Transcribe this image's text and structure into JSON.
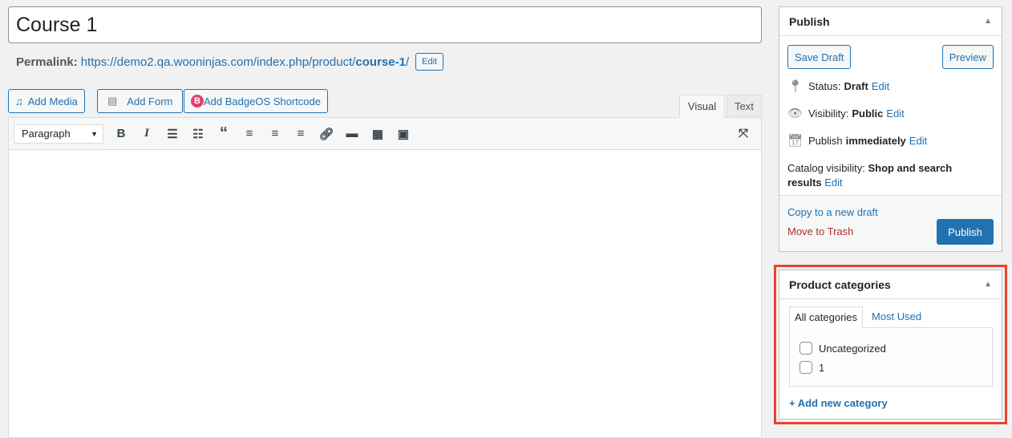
{
  "title": "Course 1",
  "permalink": {
    "label": "Permalink:",
    "base": "https://demo2.qa.wooninjas.com/index.php/product/",
    "slug": "course-1",
    "trail": "/",
    "edit": "Edit"
  },
  "media_buttons": [
    {
      "label": "Add Media"
    },
    {
      "label": "Add Form"
    },
    {
      "label": "Add BadgeOS Shortcode"
    }
  ],
  "editor_tabs": {
    "visual": "Visual",
    "text": "Text"
  },
  "toolbar": {
    "format": "Paragraph",
    "tools": [
      "bold",
      "italic",
      "bullet-list",
      "numbered-list",
      "blockquote",
      "align-left",
      "align-center",
      "align-right",
      "link",
      "read-more",
      "toolbar-toggle",
      "preview"
    ]
  },
  "publish": {
    "title": "Publish",
    "save_draft": "Save Draft",
    "preview": "Preview",
    "status_label": "Status:",
    "status": "Draft",
    "visibility_label": "Visibility:",
    "visibility": "Public",
    "publish_label": "Publish",
    "publish_when": "immediately",
    "catalog_label": "Catalog visibility:",
    "catalog": "Shop and search results",
    "edit": "Edit",
    "copy": "Copy to a new draft",
    "trash": "Move to Trash",
    "publish_btn": "Publish"
  },
  "categories": {
    "title": "Product categories",
    "tabs": [
      "All categories",
      "Most Used"
    ],
    "items": [
      {
        "label": "Uncategorized",
        "checked": false
      },
      {
        "label": "1",
        "checked": false
      }
    ],
    "add": "+ Add new category"
  },
  "colors": {
    "accent": "#2271b1",
    "trash": "#b32d2e",
    "highlight": "#e8452c",
    "badge": "#e2426f"
  }
}
